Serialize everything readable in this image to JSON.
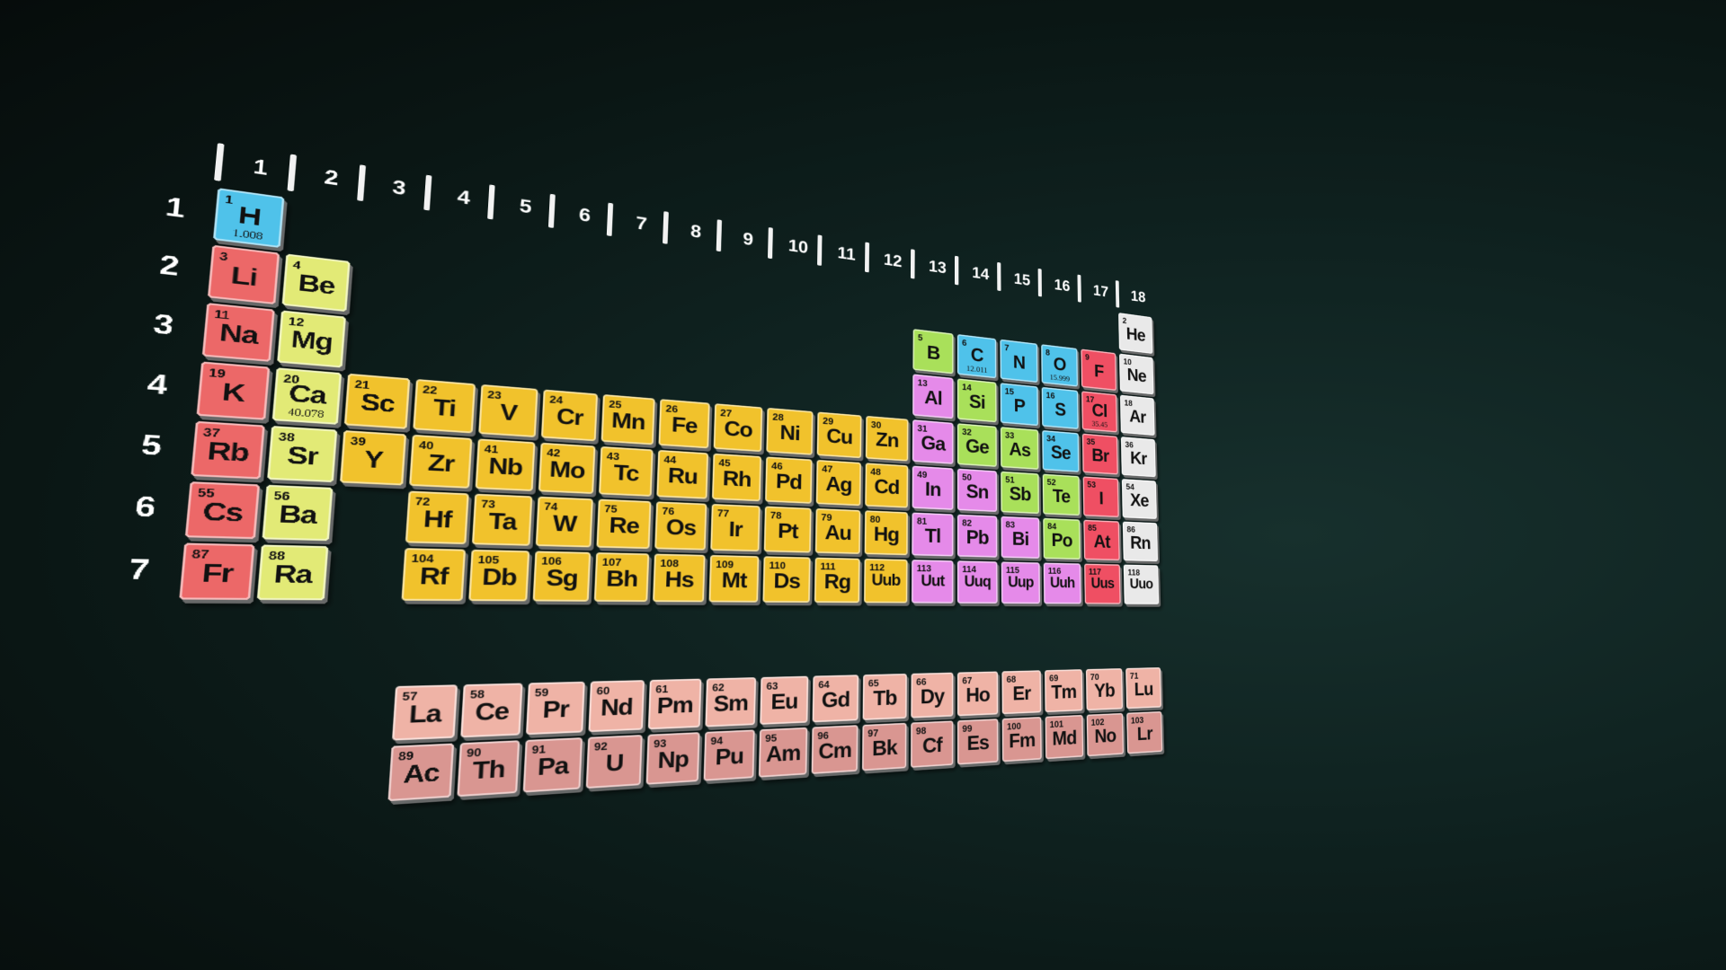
{
  "colors": {
    "alkali-metal": "#ec6868",
    "alkaline-earth": "#e2ea76",
    "transition-metal": "#f1c22c",
    "post-transition": "#e58ae9",
    "metalloid": "#a9e05a",
    "nonmetal": "#4fc2ea",
    "halogen": "#ef4f63",
    "noble-gas": "#e9e9e9",
    "lanthanide": "#efb3a6",
    "actinide": "#d99691"
  },
  "groups": [
    "1",
    "2",
    "3",
    "4",
    "5",
    "6",
    "7",
    "8",
    "9",
    "10",
    "11",
    "12",
    "13",
    "14",
    "15",
    "16",
    "17",
    "18"
  ],
  "periods": [
    "1",
    "2",
    "3",
    "4",
    "5",
    "6",
    "7"
  ],
  "elements": [
    {
      "n": "1",
      "s": "H",
      "m": "1.008",
      "r": 1,
      "c": 1,
      "cat": "nonmetal"
    },
    {
      "n": "2",
      "s": "He",
      "m": "",
      "r": 1,
      "c": 18,
      "cat": "noble-gas"
    },
    {
      "n": "3",
      "s": "Li",
      "m": "",
      "r": 2,
      "c": 1,
      "cat": "alkali-metal"
    },
    {
      "n": "4",
      "s": "Be",
      "m": "",
      "r": 2,
      "c": 2,
      "cat": "alkaline-earth"
    },
    {
      "n": "5",
      "s": "B",
      "m": "",
      "r": 2,
      "c": 13,
      "cat": "metalloid"
    },
    {
      "n": "6",
      "s": "C",
      "m": "12.011",
      "r": 2,
      "c": 14,
      "cat": "nonmetal"
    },
    {
      "n": "7",
      "s": "N",
      "m": "",
      "r": 2,
      "c": 15,
      "cat": "nonmetal"
    },
    {
      "n": "8",
      "s": "O",
      "m": "15.999",
      "r": 2,
      "c": 16,
      "cat": "nonmetal"
    },
    {
      "n": "9",
      "s": "F",
      "m": "",
      "r": 2,
      "c": 17,
      "cat": "halogen"
    },
    {
      "n": "10",
      "s": "Ne",
      "m": "",
      "r": 2,
      "c": 18,
      "cat": "noble-gas"
    },
    {
      "n": "11",
      "s": "Na",
      "m": "",
      "r": 3,
      "c": 1,
      "cat": "alkali-metal"
    },
    {
      "n": "12",
      "s": "Mg",
      "m": "",
      "r": 3,
      "c": 2,
      "cat": "alkaline-earth"
    },
    {
      "n": "13",
      "s": "Al",
      "m": "",
      "r": 3,
      "c": 13,
      "cat": "post-transition"
    },
    {
      "n": "14",
      "s": "Si",
      "m": "",
      "r": 3,
      "c": 14,
      "cat": "metalloid"
    },
    {
      "n": "15",
      "s": "P",
      "m": "",
      "r": 3,
      "c": 15,
      "cat": "nonmetal"
    },
    {
      "n": "16",
      "s": "S",
      "m": "",
      "r": 3,
      "c": 16,
      "cat": "nonmetal"
    },
    {
      "n": "17",
      "s": "Cl",
      "m": "35.45",
      "r": 3,
      "c": 17,
      "cat": "halogen"
    },
    {
      "n": "18",
      "s": "Ar",
      "m": "",
      "r": 3,
      "c": 18,
      "cat": "noble-gas"
    },
    {
      "n": "19",
      "s": "K",
      "m": "",
      "r": 4,
      "c": 1,
      "cat": "alkali-metal"
    },
    {
      "n": "20",
      "s": "Ca",
      "m": "40.078",
      "r": 4,
      "c": 2,
      "cat": "alkaline-earth"
    },
    {
      "n": "21",
      "s": "Sc",
      "m": "",
      "r": 4,
      "c": 3,
      "cat": "transition-metal"
    },
    {
      "n": "22",
      "s": "Ti",
      "m": "",
      "r": 4,
      "c": 4,
      "cat": "transition-metal"
    },
    {
      "n": "23",
      "s": "V",
      "m": "",
      "r": 4,
      "c": 5,
      "cat": "transition-metal"
    },
    {
      "n": "24",
      "s": "Cr",
      "m": "",
      "r": 4,
      "c": 6,
      "cat": "transition-metal"
    },
    {
      "n": "25",
      "s": "Mn",
      "m": "",
      "r": 4,
      "c": 7,
      "cat": "transition-metal"
    },
    {
      "n": "26",
      "s": "Fe",
      "m": "",
      "r": 4,
      "c": 8,
      "cat": "transition-metal"
    },
    {
      "n": "27",
      "s": "Co",
      "m": "",
      "r": 4,
      "c": 9,
      "cat": "transition-metal"
    },
    {
      "n": "28",
      "s": "Ni",
      "m": "",
      "r": 4,
      "c": 10,
      "cat": "transition-metal"
    },
    {
      "n": "29",
      "s": "Cu",
      "m": "",
      "r": 4,
      "c": 11,
      "cat": "transition-metal"
    },
    {
      "n": "30",
      "s": "Zn",
      "m": "",
      "r": 4,
      "c": 12,
      "cat": "transition-metal"
    },
    {
      "n": "31",
      "s": "Ga",
      "m": "",
      "r": 4,
      "c": 13,
      "cat": "post-transition"
    },
    {
      "n": "32",
      "s": "Ge",
      "m": "",
      "r": 4,
      "c": 14,
      "cat": "metalloid"
    },
    {
      "n": "33",
      "s": "As",
      "m": "",
      "r": 4,
      "c": 15,
      "cat": "metalloid"
    },
    {
      "n": "34",
      "s": "Se",
      "m": "",
      "r": 4,
      "c": 16,
      "cat": "nonmetal"
    },
    {
      "n": "35",
      "s": "Br",
      "m": "",
      "r": 4,
      "c": 17,
      "cat": "halogen"
    },
    {
      "n": "36",
      "s": "Kr",
      "m": "",
      "r": 4,
      "c": 18,
      "cat": "noble-gas"
    },
    {
      "n": "37",
      "s": "Rb",
      "m": "",
      "r": 5,
      "c": 1,
      "cat": "alkali-metal"
    },
    {
      "n": "38",
      "s": "Sr",
      "m": "",
      "r": 5,
      "c": 2,
      "cat": "alkaline-earth"
    },
    {
      "n": "39",
      "s": "Y",
      "m": "",
      "r": 5,
      "c": 3,
      "cat": "transition-metal"
    },
    {
      "n": "40",
      "s": "Zr",
      "m": "",
      "r": 5,
      "c": 4,
      "cat": "transition-metal"
    },
    {
      "n": "41",
      "s": "Nb",
      "m": "",
      "r": 5,
      "c": 5,
      "cat": "transition-metal"
    },
    {
      "n": "42",
      "s": "Mo",
      "m": "",
      "r": 5,
      "c": 6,
      "cat": "transition-metal"
    },
    {
      "n": "43",
      "s": "Tc",
      "m": "",
      "r": 5,
      "c": 7,
      "cat": "transition-metal"
    },
    {
      "n": "44",
      "s": "Ru",
      "m": "",
      "r": 5,
      "c": 8,
      "cat": "transition-metal"
    },
    {
      "n": "45",
      "s": "Rh",
      "m": "",
      "r": 5,
      "c": 9,
      "cat": "transition-metal"
    },
    {
      "n": "46",
      "s": "Pd",
      "m": "",
      "r": 5,
      "c": 10,
      "cat": "transition-metal"
    },
    {
      "n": "47",
      "s": "Ag",
      "m": "",
      "r": 5,
      "c": 11,
      "cat": "transition-metal"
    },
    {
      "n": "48",
      "s": "Cd",
      "m": "",
      "r": 5,
      "c": 12,
      "cat": "transition-metal"
    },
    {
      "n": "49",
      "s": "In",
      "m": "",
      "r": 5,
      "c": 13,
      "cat": "post-transition"
    },
    {
      "n": "50",
      "s": "Sn",
      "m": "",
      "r": 5,
      "c": 14,
      "cat": "post-transition"
    },
    {
      "n": "51",
      "s": "Sb",
      "m": "",
      "r": 5,
      "c": 15,
      "cat": "metalloid"
    },
    {
      "n": "52",
      "s": "Te",
      "m": "",
      "r": 5,
      "c": 16,
      "cat": "metalloid"
    },
    {
      "n": "53",
      "s": "I",
      "m": "",
      "r": 5,
      "c": 17,
      "cat": "halogen"
    },
    {
      "n": "54",
      "s": "Xe",
      "m": "",
      "r": 5,
      "c": 18,
      "cat": "noble-gas"
    },
    {
      "n": "55",
      "s": "Cs",
      "m": "",
      "r": 6,
      "c": 1,
      "cat": "alkali-metal"
    },
    {
      "n": "56",
      "s": "Ba",
      "m": "",
      "r": 6,
      "c": 2,
      "cat": "alkaline-earth"
    },
    {
      "n": "72",
      "s": "Hf",
      "m": "",
      "r": 6,
      "c": 4,
      "cat": "transition-metal"
    },
    {
      "n": "73",
      "s": "Ta",
      "m": "",
      "r": 6,
      "c": 5,
      "cat": "transition-metal"
    },
    {
      "n": "74",
      "s": "W",
      "m": "",
      "r": 6,
      "c": 6,
      "cat": "transition-metal"
    },
    {
      "n": "75",
      "s": "Re",
      "m": "",
      "r": 6,
      "c": 7,
      "cat": "transition-metal"
    },
    {
      "n": "76",
      "s": "Os",
      "m": "",
      "r": 6,
      "c": 8,
      "cat": "transition-metal"
    },
    {
      "n": "77",
      "s": "Ir",
      "m": "",
      "r": 6,
      "c": 9,
      "cat": "transition-metal"
    },
    {
      "n": "78",
      "s": "Pt",
      "m": "",
      "r": 6,
      "c": 10,
      "cat": "transition-metal"
    },
    {
      "n": "79",
      "s": "Au",
      "m": "",
      "r": 6,
      "c": 11,
      "cat": "transition-metal"
    },
    {
      "n": "80",
      "s": "Hg",
      "m": "",
      "r": 6,
      "c": 12,
      "cat": "transition-metal"
    },
    {
      "n": "81",
      "s": "Tl",
      "m": "",
      "r": 6,
      "c": 13,
      "cat": "post-transition"
    },
    {
      "n": "82",
      "s": "Pb",
      "m": "",
      "r": 6,
      "c": 14,
      "cat": "post-transition"
    },
    {
      "n": "83",
      "s": "Bi",
      "m": "",
      "r": 6,
      "c": 15,
      "cat": "post-transition"
    },
    {
      "n": "84",
      "s": "Po",
      "m": "",
      "r": 6,
      "c": 16,
      "cat": "metalloid"
    },
    {
      "n": "85",
      "s": "At",
      "m": "",
      "r": 6,
      "c": 17,
      "cat": "halogen"
    },
    {
      "n": "86",
      "s": "Rn",
      "m": "",
      "r": 6,
      "c": 18,
      "cat": "noble-gas"
    },
    {
      "n": "87",
      "s": "Fr",
      "m": "",
      "r": 7,
      "c": 1,
      "cat": "alkali-metal"
    },
    {
      "n": "88",
      "s": "Ra",
      "m": "",
      "r": 7,
      "c": 2,
      "cat": "alkaline-earth"
    },
    {
      "n": "104",
      "s": "Rf",
      "m": "",
      "r": 7,
      "c": 4,
      "cat": "transition-metal"
    },
    {
      "n": "105",
      "s": "Db",
      "m": "",
      "r": 7,
      "c": 5,
      "cat": "transition-metal"
    },
    {
      "n": "106",
      "s": "Sg",
      "m": "",
      "r": 7,
      "c": 6,
      "cat": "transition-metal"
    },
    {
      "n": "107",
      "s": "Bh",
      "m": "",
      "r": 7,
      "c": 7,
      "cat": "transition-metal"
    },
    {
      "n": "108",
      "s": "Hs",
      "m": "",
      "r": 7,
      "c": 8,
      "cat": "transition-metal"
    },
    {
      "n": "109",
      "s": "Mt",
      "m": "",
      "r": 7,
      "c": 9,
      "cat": "transition-metal"
    },
    {
      "n": "110",
      "s": "Ds",
      "m": "",
      "r": 7,
      "c": 10,
      "cat": "transition-metal"
    },
    {
      "n": "111",
      "s": "Rg",
      "m": "",
      "r": 7,
      "c": 11,
      "cat": "transition-metal"
    },
    {
      "n": "112",
      "s": "Uub",
      "m": "",
      "r": 7,
      "c": 12,
      "cat": "transition-metal"
    },
    {
      "n": "113",
      "s": "Uut",
      "m": "",
      "r": 7,
      "c": 13,
      "cat": "post-transition"
    },
    {
      "n": "114",
      "s": "Uuq",
      "m": "",
      "r": 7,
      "c": 14,
      "cat": "post-transition"
    },
    {
      "n": "115",
      "s": "Uup",
      "m": "",
      "r": 7,
      "c": 15,
      "cat": "post-transition"
    },
    {
      "n": "116",
      "s": "Uuh",
      "m": "",
      "r": 7,
      "c": 16,
      "cat": "post-transition"
    },
    {
      "n": "117",
      "s": "Uus",
      "m": "",
      "r": 7,
      "c": 17,
      "cat": "halogen"
    },
    {
      "n": "118",
      "s": "Uuo",
      "m": "",
      "r": 7,
      "c": 18,
      "cat": "noble-gas"
    },
    {
      "n": "57",
      "s": "La",
      "m": "",
      "r": 9,
      "c": 4,
      "cat": "lanthanide"
    },
    {
      "n": "58",
      "s": "Ce",
      "m": "",
      "r": 9,
      "c": 5,
      "cat": "lanthanide"
    },
    {
      "n": "59",
      "s": "Pr",
      "m": "",
      "r": 9,
      "c": 6,
      "cat": "lanthanide"
    },
    {
      "n": "60",
      "s": "Nd",
      "m": "",
      "r": 9,
      "c": 7,
      "cat": "lanthanide"
    },
    {
      "n": "61",
      "s": "Pm",
      "m": "",
      "r": 9,
      "c": 8,
      "cat": "lanthanide"
    },
    {
      "n": "62",
      "s": "Sm",
      "m": "",
      "r": 9,
      "c": 9,
      "cat": "lanthanide"
    },
    {
      "n": "63",
      "s": "Eu",
      "m": "",
      "r": 9,
      "c": 10,
      "cat": "lanthanide"
    },
    {
      "n": "64",
      "s": "Gd",
      "m": "",
      "r": 9,
      "c": 11,
      "cat": "lanthanide"
    },
    {
      "n": "65",
      "s": "Tb",
      "m": "",
      "r": 9,
      "c": 12,
      "cat": "lanthanide"
    },
    {
      "n": "66",
      "s": "Dy",
      "m": "",
      "r": 9,
      "c": 13,
      "cat": "lanthanide"
    },
    {
      "n": "67",
      "s": "Ho",
      "m": "",
      "r": 9,
      "c": 14,
      "cat": "lanthanide"
    },
    {
      "n": "68",
      "s": "Er",
      "m": "",
      "r": 9,
      "c": 15,
      "cat": "lanthanide"
    },
    {
      "n": "69",
      "s": "Tm",
      "m": "",
      "r": 9,
      "c": 16,
      "cat": "lanthanide"
    },
    {
      "n": "70",
      "s": "Yb",
      "m": "",
      "r": 9,
      "c": 17,
      "cat": "lanthanide"
    },
    {
      "n": "71",
      "s": "Lu",
      "m": "",
      "r": 9,
      "c": 18,
      "cat": "lanthanide"
    },
    {
      "n": "89",
      "s": "Ac",
      "m": "",
      "r": 10,
      "c": 4,
      "cat": "actinide"
    },
    {
      "n": "90",
      "s": "Th",
      "m": "",
      "r": 10,
      "c": 5,
      "cat": "actinide"
    },
    {
      "n": "91",
      "s": "Pa",
      "m": "",
      "r": 10,
      "c": 6,
      "cat": "actinide"
    },
    {
      "n": "92",
      "s": "U",
      "m": "",
      "r": 10,
      "c": 7,
      "cat": "actinide"
    },
    {
      "n": "93",
      "s": "Np",
      "m": "",
      "r": 10,
      "c": 8,
      "cat": "actinide"
    },
    {
      "n": "94",
      "s": "Pu",
      "m": "",
      "r": 10,
      "c": 9,
      "cat": "actinide"
    },
    {
      "n": "95",
      "s": "Am",
      "m": "",
      "r": 10,
      "c": 10,
      "cat": "actinide"
    },
    {
      "n": "96",
      "s": "Cm",
      "m": "",
      "r": 10,
      "c": 11,
      "cat": "actinide"
    },
    {
      "n": "97",
      "s": "Bk",
      "m": "",
      "r": 10,
      "c": 12,
      "cat": "actinide"
    },
    {
      "n": "98",
      "s": "Cf",
      "m": "",
      "r": 10,
      "c": 13,
      "cat": "actinide"
    },
    {
      "n": "99",
      "s": "Es",
      "m": "",
      "r": 10,
      "c": 14,
      "cat": "actinide"
    },
    {
      "n": "100",
      "s": "Fm",
      "m": "",
      "r": 10,
      "c": 15,
      "cat": "actinide"
    },
    {
      "n": "101",
      "s": "Md",
      "m": "",
      "r": 10,
      "c": 16,
      "cat": "actinide"
    },
    {
      "n": "102",
      "s": "No",
      "m": "",
      "r": 10,
      "c": 17,
      "cat": "actinide"
    },
    {
      "n": "103",
      "s": "Lr",
      "m": "",
      "r": 10,
      "c": 18,
      "cat": "actinide"
    }
  ]
}
